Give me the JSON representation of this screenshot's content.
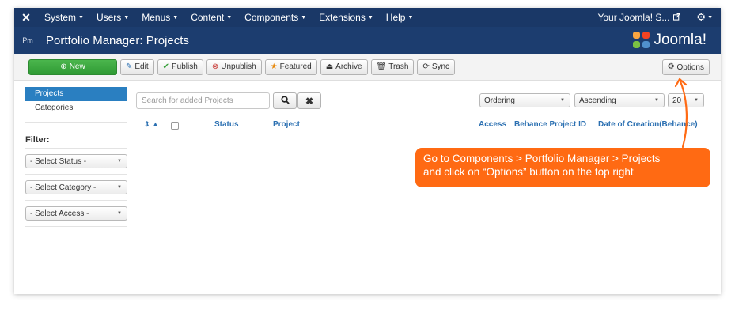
{
  "topnav": {
    "items": [
      {
        "label": "System"
      },
      {
        "label": "Users"
      },
      {
        "label": "Menus"
      },
      {
        "label": "Content"
      },
      {
        "label": "Components"
      },
      {
        "label": "Extensions"
      },
      {
        "label": "Help"
      }
    ],
    "site_label": "Your Joomla! S...",
    "site_icon": "external-link-icon",
    "settings_icon": "gear-icon"
  },
  "header": {
    "component_icon_text": "Pm",
    "title": "Portfolio Manager: Projects",
    "brand_text": "Joomla!"
  },
  "toolbar": {
    "new_label": "New",
    "edit_label": "Edit",
    "publish_label": "Publish",
    "unpublish_label": "Unpublish",
    "featured_label": "Featured",
    "archive_label": "Archive",
    "trash_label": "Trash",
    "sync_label": "Sync",
    "options_label": "Options"
  },
  "sidebar": {
    "items": [
      {
        "label": "Projects",
        "active": true
      },
      {
        "label": "Categories",
        "active": false
      }
    ],
    "filter_title": "Filter:",
    "filters": [
      {
        "label": "- Select Status -"
      },
      {
        "label": "- Select Category -"
      },
      {
        "label": "- Select Access -"
      }
    ]
  },
  "search": {
    "placeholder": "Search for added Projects"
  },
  "list_controls": {
    "ordering": "Ordering",
    "direction": "Ascending",
    "limit": "20"
  },
  "table": {
    "headers": {
      "status": "Status",
      "project": "Project",
      "access": "Access",
      "behance_id": "Behance Project ID",
      "date": "Date of Creation(Behance)"
    }
  },
  "callout": {
    "line1": "Go to Components > Portfolio Manager > Projects",
    "line2": "and  click on “Options” button on the top right"
  },
  "colors": {
    "nav_bg": "#1a3867",
    "header_bg": "#1c3d6f",
    "new_button": "#3aa53d",
    "active_sidebar": "#2a7fc1",
    "link_blue": "#2a6fb1",
    "callout": "#ff6a13"
  }
}
